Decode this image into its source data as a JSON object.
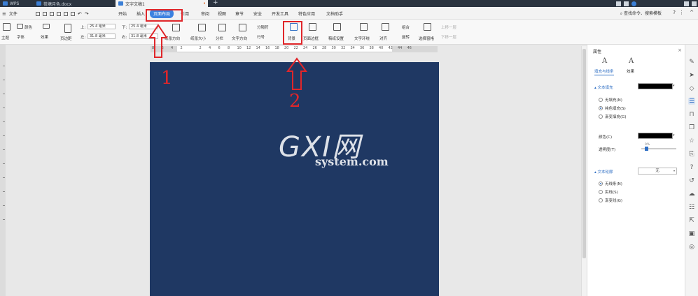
{
  "titlebar": {
    "tabs": [
      {
        "label": "WPS"
      },
      {
        "label": "荷塘月色.docx"
      },
      {
        "label": "文字文稿1"
      }
    ],
    "new_tab": "+"
  },
  "menubar": {
    "file": "文件",
    "items": [
      "开始",
      "插入",
      "页面布局",
      "引用",
      "审阅",
      "视图",
      "章节",
      "安全",
      "开发工具",
      "特色应用",
      "文档助手"
    ],
    "active": "页面布局",
    "search": "查找命令、搜索模板",
    "help": "?",
    "more": "⋮",
    "collapse": "^"
  },
  "ribbon": {
    "theme": "主题",
    "colors": "颜色",
    "font": "字体",
    "effects": "效果",
    "margins": "页边距",
    "top_label": "上:",
    "top_value": "25.4 毫米",
    "bottom_label": "下:",
    "bottom_value": "25.4 毫米",
    "left_label": "左:",
    "left_value": "31.8 毫米",
    "right_label": "右:",
    "right_value": "31.8 毫米",
    "orientation": "纸张方向",
    "size": "纸张大小",
    "columns": "分栏",
    "text_direction": "文字方向",
    "breaks": "分隔符",
    "line_numbers": "行号",
    "background": "背景",
    "page_border": "页面边框",
    "draft_grid": "稿纸设置",
    "text_wrap": "文字环绕",
    "align": "对齐",
    "group": "组合",
    "rotate": "旋转",
    "selection_pane": "选择窗格",
    "bring_forward": "上移一层",
    "send_backward": "下移一层"
  },
  "ruler": {
    "numbers": [
      "8",
      "6",
      "4",
      "2",
      "",
      "2",
      "4",
      "6",
      "8",
      "10",
      "12",
      "14",
      "16",
      "18",
      "20",
      "22",
      "24",
      "26",
      "28",
      "30",
      "32",
      "34",
      "36",
      "38",
      "40",
      "42",
      "44",
      "46"
    ]
  },
  "page": {
    "background_color": "#1f3863"
  },
  "panel": {
    "title": "属性",
    "close": "×",
    "tab_fill": "填充与线条",
    "tab_effect": "效果",
    "fill_section": "文本填充",
    "fill_options": [
      {
        "label": "无填充(N)",
        "checked": false
      },
      {
        "label": "纯色填充(S)",
        "checked": true
      },
      {
        "label": "渐变填充(G)",
        "checked": false
      }
    ],
    "color_label": "颜色(C)",
    "transparency_label": "透明度(T)",
    "transparency_value": "0%",
    "outline_section": "文本轮廓",
    "outline_value": "无",
    "outline_options": [
      {
        "label": "无线条(N)",
        "checked": true
      },
      {
        "label": "实线(S)",
        "checked": false
      },
      {
        "label": "渐变线(G)",
        "checked": false
      }
    ]
  },
  "annotations": {
    "step1": "1",
    "step2": "2"
  },
  "watermark": {
    "big": "GXI网",
    "small": "system.com"
  }
}
